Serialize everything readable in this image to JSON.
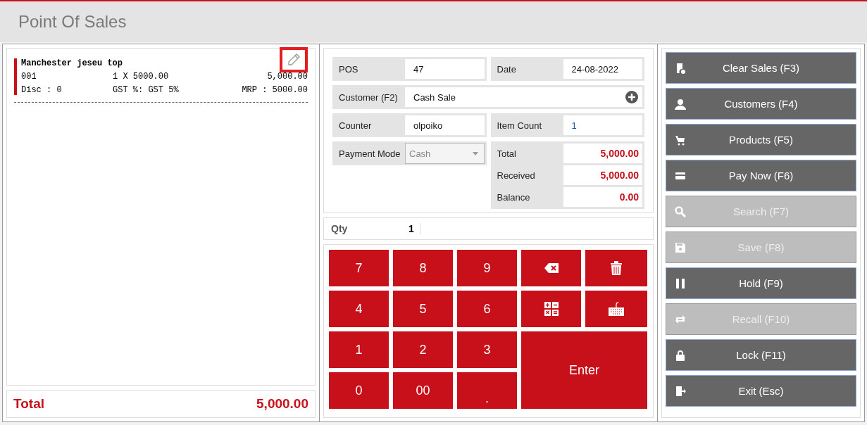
{
  "header": {
    "title": "Point Of Sales"
  },
  "cart": {
    "items": [
      {
        "name": "Manchester jeseu top",
        "code": "001",
        "qty_price": "1 X 5000.00",
        "amount": "5,000.00",
        "disc": "Disc :  0",
        "gst": "GST %: GST 5%",
        "mrp": "MRP :  5000.00"
      }
    ],
    "total_label": "Total",
    "total_value": "5,000.00"
  },
  "form": {
    "pos": {
      "label": "POS",
      "value": "47"
    },
    "date": {
      "label": "Date",
      "value": "24-08-2022"
    },
    "customer": {
      "label": "Customer (F2)",
      "value": "Cash Sale"
    },
    "counter": {
      "label": "Counter",
      "value": "olpoiko"
    },
    "item_count": {
      "label": "Item Count",
      "value": "1"
    },
    "payment_mode": {
      "label": "Payment Mode",
      "value": "Cash",
      "disabled": true
    },
    "totals": [
      {
        "label": "Total",
        "value": "5,000.00"
      },
      {
        "label": "Received",
        "value": "5,000.00"
      },
      {
        "label": "Balance",
        "value": "0.00"
      }
    ]
  },
  "qty": {
    "label": "Qty",
    "value": "1"
  },
  "keypad": [
    {
      "kind": "digit",
      "label": "7"
    },
    {
      "kind": "digit",
      "label": "8"
    },
    {
      "kind": "digit",
      "label": "9"
    },
    {
      "kind": "backspace"
    },
    {
      "kind": "delete"
    },
    {
      "kind": "digit",
      "label": "4"
    },
    {
      "kind": "digit",
      "label": "5"
    },
    {
      "kind": "digit",
      "label": "6"
    },
    {
      "kind": "calculator"
    },
    {
      "kind": "keyboard"
    },
    {
      "kind": "digit",
      "label": "1"
    },
    {
      "kind": "digit",
      "label": "2"
    },
    {
      "kind": "digit",
      "label": "3"
    },
    {
      "kind": "enter",
      "label": "Enter"
    },
    {
      "kind": "digit",
      "label": "0"
    },
    {
      "kind": "digit",
      "label": "00"
    },
    {
      "kind": "dot",
      "label": "."
    }
  ],
  "actions": [
    {
      "label": "Clear Sales (F3)",
      "disabled": false
    },
    {
      "label": "Customers (F4)",
      "disabled": false
    },
    {
      "label": "Products (F5)",
      "disabled": false
    },
    {
      "label": "Pay Now (F6)",
      "disabled": false
    },
    {
      "label": "Search (F7)",
      "disabled": true
    },
    {
      "label": "Save (F8)",
      "disabled": true
    },
    {
      "label": "Hold (F9)",
      "disabled": false
    },
    {
      "label": "Recall (F10)",
      "disabled": true
    },
    {
      "label": "Lock (F11)",
      "disabled": false
    },
    {
      "label": "Exit (Esc)",
      "disabled": false
    }
  ]
}
